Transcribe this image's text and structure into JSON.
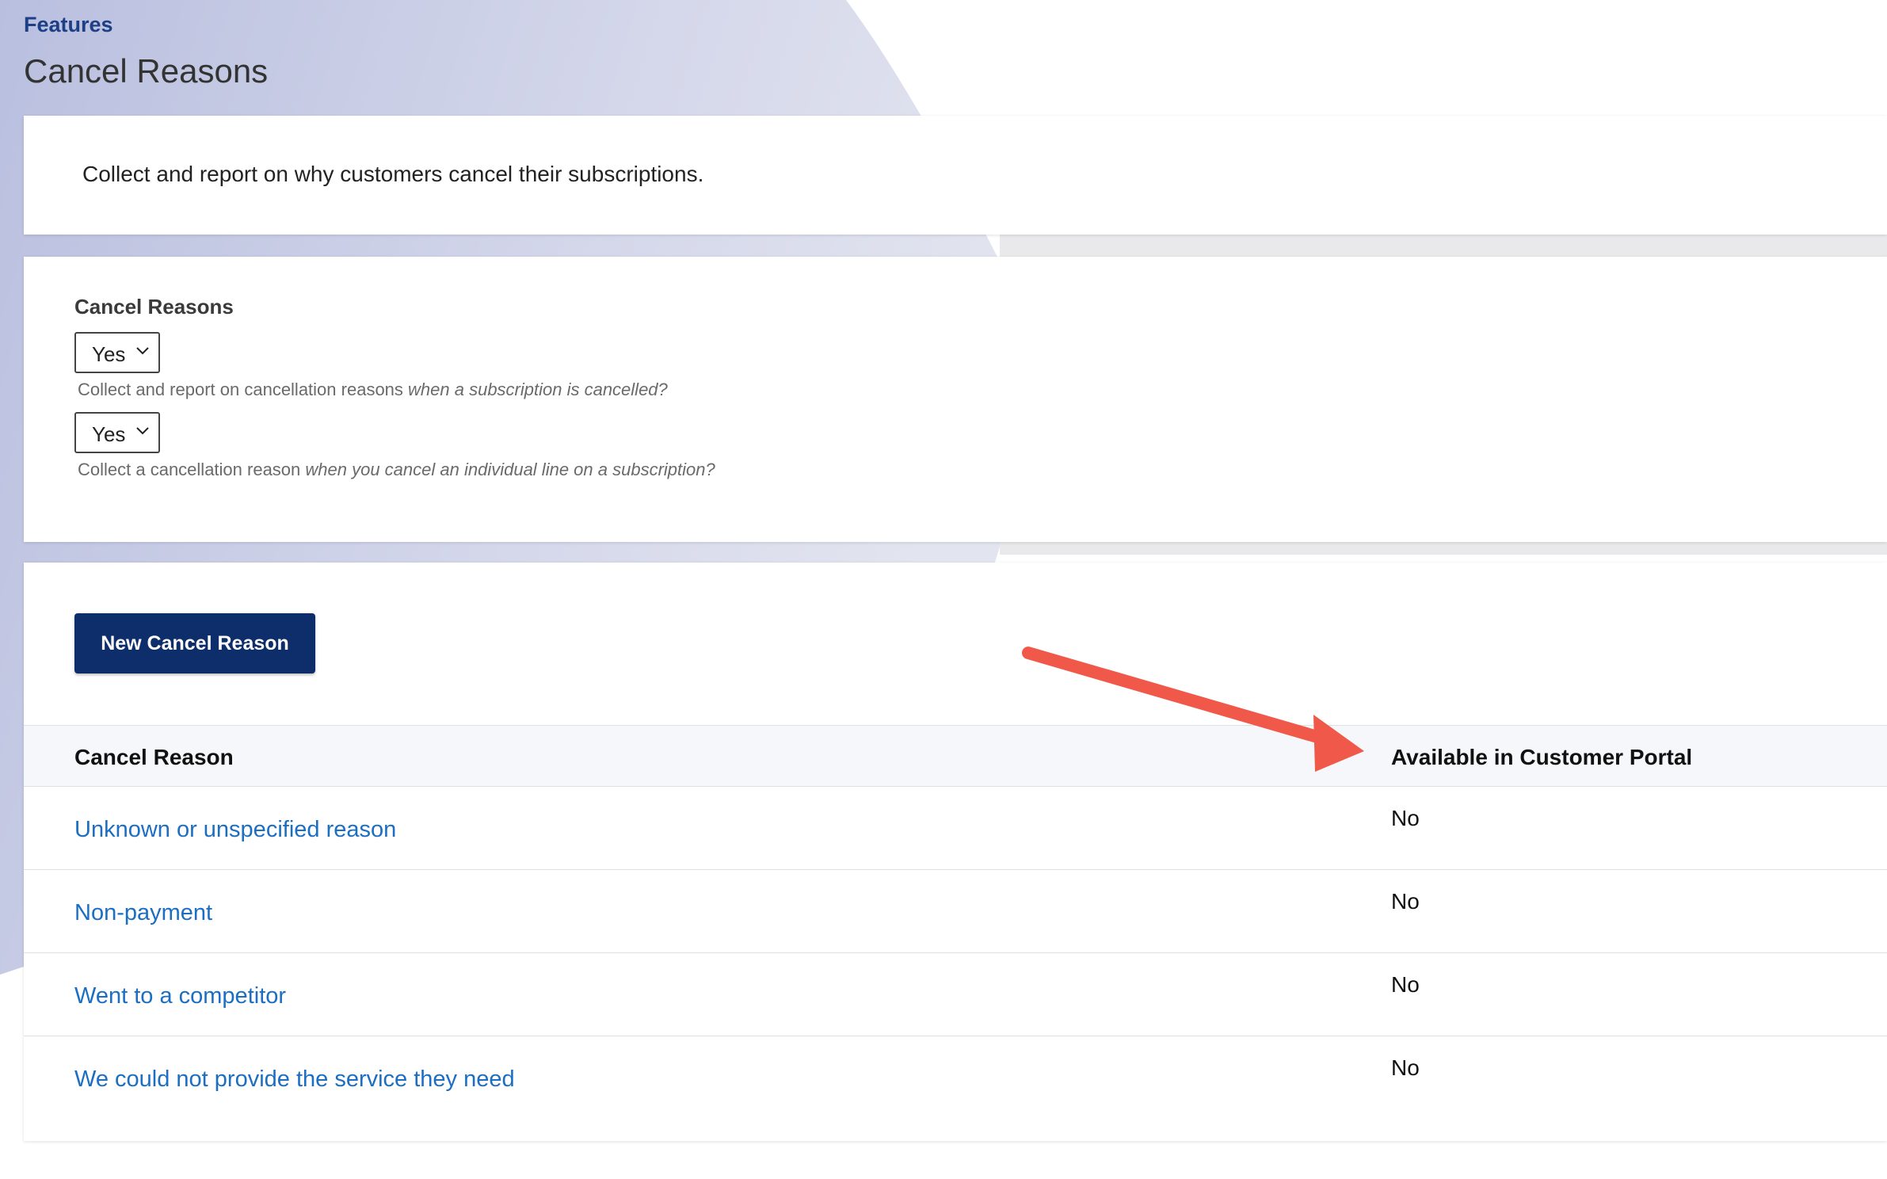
{
  "header": {
    "breadcrumb": "Features",
    "title": "Cancel Reasons"
  },
  "intro": {
    "text": "Collect and report on why customers cancel their subscriptions."
  },
  "settings": {
    "label": "Cancel Reasons",
    "select1": {
      "value": "Yes",
      "help_plain": "Collect and report on cancellation reasons ",
      "help_italic": "when a subscription is cancelled?"
    },
    "select2": {
      "value": "Yes",
      "help_plain": "Collect a cancellation reason ",
      "help_italic": "when you cancel an individual line on a subscription?"
    }
  },
  "actions": {
    "new_button": "New Cancel Reason"
  },
  "table": {
    "columns": [
      "Cancel Reason",
      "Available in Customer Portal"
    ],
    "rows": [
      {
        "reason": "Unknown or unspecified reason",
        "portal": "No"
      },
      {
        "reason": "Non-payment",
        "portal": "No"
      },
      {
        "reason": "Went to a competitor",
        "portal": "No"
      },
      {
        "reason": "We could not provide the service they need",
        "portal": "No"
      }
    ]
  },
  "colors": {
    "brand": "#0e2d6b",
    "link": "#1b6ec2",
    "annotation_arrow": "#f0594a",
    "background_wash": "#c9cde6"
  },
  "annotation": {
    "arrow_icon": "red-arrow-pointing-to-portal-column"
  }
}
